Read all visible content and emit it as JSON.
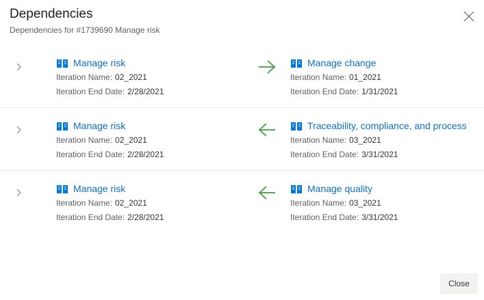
{
  "dialog": {
    "title": "Dependencies",
    "subtitle": "Dependencies for #1739690 Manage risk",
    "close_button_label": "Close"
  },
  "labels": {
    "iteration_name": "Iteration Name:",
    "iteration_end_date": "Iteration End Date:"
  },
  "colors": {
    "link": "#106ebe",
    "book_icon": "#0078d4",
    "arrow": "#5a9f58"
  },
  "dependencies": [
    {
      "direction": "right",
      "left": {
        "title": "Manage risk",
        "iteration_name": "02_2021",
        "end_date": "2/28/2021"
      },
      "right": {
        "title": "Manage change",
        "iteration_name": "01_2021",
        "end_date": "1/31/2021"
      }
    },
    {
      "direction": "left",
      "left": {
        "title": "Manage risk",
        "iteration_name": "02_2021",
        "end_date": "2/28/2021"
      },
      "right": {
        "title": "Traceability, compliance, and process",
        "iteration_name": "03_2021",
        "end_date": "3/31/2021"
      }
    },
    {
      "direction": "left",
      "left": {
        "title": "Manage risk",
        "iteration_name": "02_2021",
        "end_date": "2/28/2021"
      },
      "right": {
        "title": "Manage quality",
        "iteration_name": "03_2021",
        "end_date": "3/31/2021"
      }
    }
  ]
}
